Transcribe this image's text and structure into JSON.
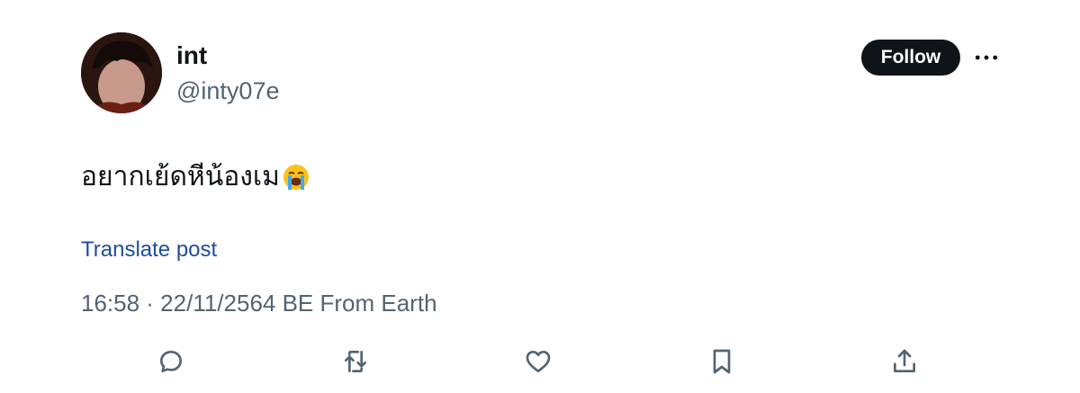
{
  "author": {
    "display_name": "int",
    "handle": "@inty07e"
  },
  "header": {
    "follow_label": "Follow"
  },
  "post": {
    "text": "อยากเย้ดหีน้องเม",
    "emoji": "loudly-crying-face-emoji"
  },
  "translate_label": "Translate post",
  "meta": {
    "text": "16:58 · 22/11/2564 BE From Earth"
  },
  "actions": [
    "reply-icon",
    "retweet-icon",
    "like-icon",
    "bookmark-icon",
    "share-icon"
  ],
  "colors": {
    "text": "#0f1419",
    "secondary": "#536471",
    "link": "#1d4ea0",
    "follow_bg": "#0f1419"
  }
}
